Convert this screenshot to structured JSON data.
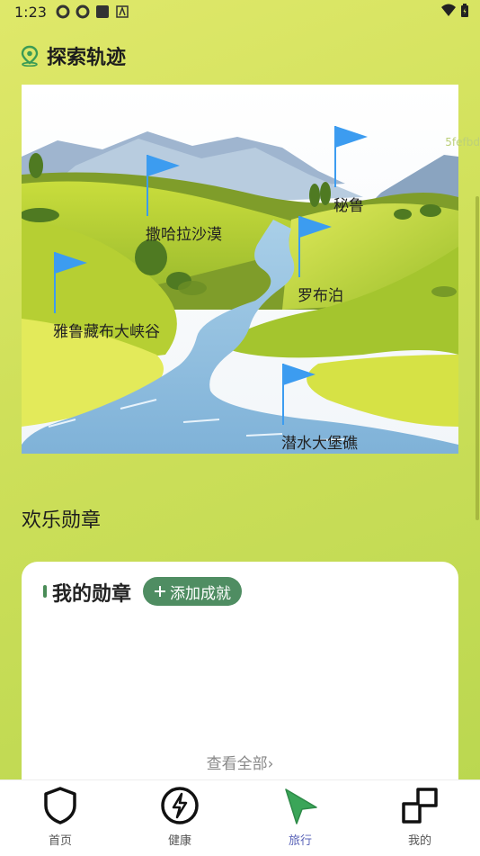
{
  "status": {
    "time": "1:23"
  },
  "explore": {
    "title": "探索轨迹",
    "watermark": "5fefbd",
    "flags": [
      {
        "id": "peru",
        "label": "秘鲁"
      },
      {
        "id": "sahara",
        "label": "撒哈拉沙漠"
      },
      {
        "id": "lopnur",
        "label": "罗布泊"
      },
      {
        "id": "yarlung",
        "label": "雅鲁藏布大峡谷"
      },
      {
        "id": "dive",
        "label": "潜水大堡礁"
      }
    ]
  },
  "medals": {
    "section_title": "欢乐勋章",
    "card_title": "我的勋章",
    "add_button": "添加成就",
    "view_all": "查看全部",
    "view_all_chevron": "›"
  },
  "tabbar": {
    "items": [
      {
        "label": "首页",
        "icon": "shield-icon"
      },
      {
        "label": "健康",
        "icon": "lightning-icon"
      },
      {
        "label": "旅行",
        "icon": "navigation-arrow-icon",
        "active": true
      },
      {
        "label": "我的",
        "icon": "profile-blocks-icon"
      }
    ]
  },
  "colors": {
    "accent_green": "#4f8d62",
    "active_tab": "#5a63b8",
    "flag_blue": "#3c9cf0"
  }
}
